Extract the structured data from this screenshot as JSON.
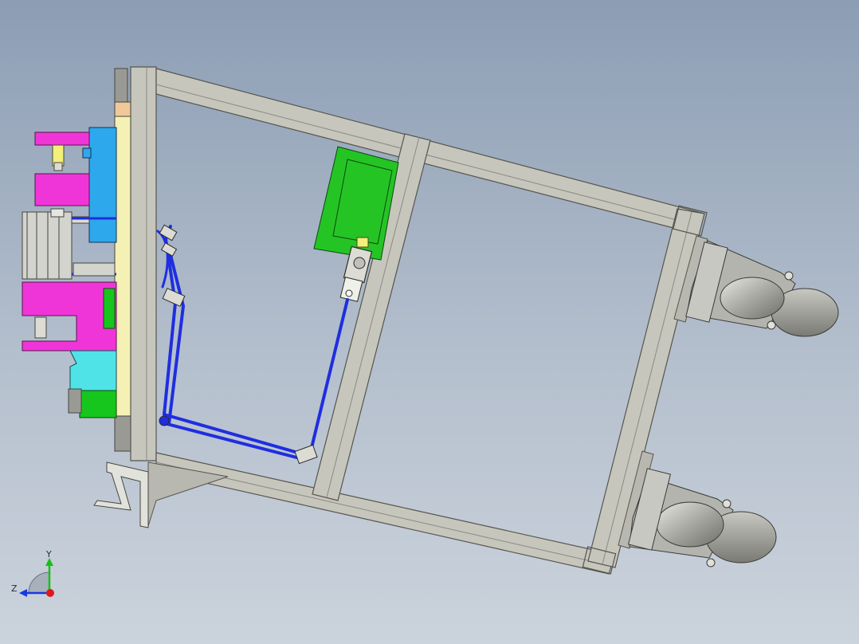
{
  "view": {
    "background_top": "#8c9db4",
    "background_bottom": "#cbd3dc"
  },
  "colors": {
    "frame": "#c6c6bd",
    "frame_edge": "#55554e",
    "plate": "#f5f0b4",
    "plate_orange": "#f0c89a",
    "magenta": "#f035d8",
    "cyan_block": "#2ea8ec",
    "light_cyan": "#4fe3e8",
    "green_block": "#17c61c",
    "green_panel": "#25c425",
    "tube_blue": "#1f2ee0",
    "wheel_grey": "#a6a6a0",
    "fixture_grey": "#9a9a94",
    "axis_x": "#e01818",
    "axis_y": "#18c018",
    "axis_z": "#1838e0"
  },
  "triad": {
    "y_label": "Y",
    "z_label": "Z"
  }
}
